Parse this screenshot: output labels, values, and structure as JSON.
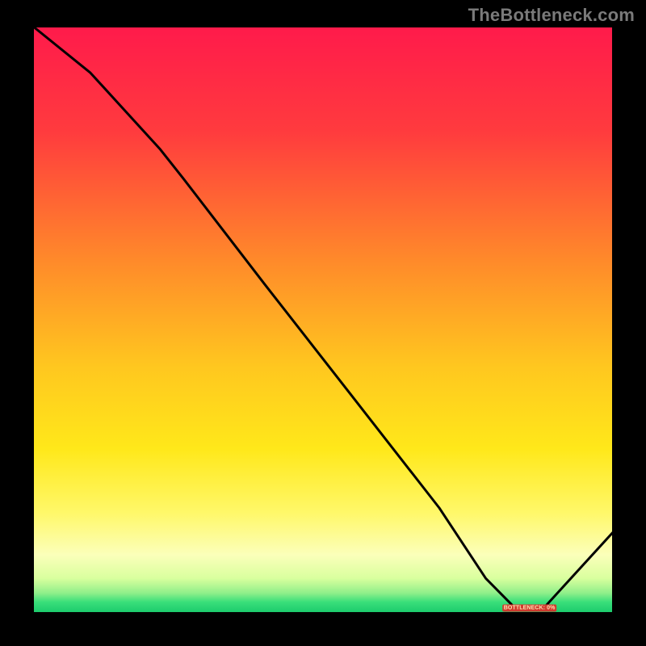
{
  "watermark": "TheBottleneck.com",
  "badge_label": "BOTTLENECK: 0%",
  "chart_data": {
    "type": "line",
    "title": "",
    "xlabel": "",
    "ylabel": "",
    "xlim": [
      0,
      100
    ],
    "ylim": [
      0,
      100
    ],
    "grid": false,
    "legend": false,
    "gradient_stops": [
      {
        "offset": 0,
        "color": "#ff1a4b"
      },
      {
        "offset": 18,
        "color": "#ff3b3e"
      },
      {
        "offset": 40,
        "color": "#ff8a2a"
      },
      {
        "offset": 58,
        "color": "#ffc71f"
      },
      {
        "offset": 72,
        "color": "#ffe81a"
      },
      {
        "offset": 83,
        "color": "#fff86b"
      },
      {
        "offset": 90,
        "color": "#fbffba"
      },
      {
        "offset": 94,
        "color": "#d9ff9e"
      },
      {
        "offset": 96.5,
        "color": "#8fef8a"
      },
      {
        "offset": 98,
        "color": "#3adf7a"
      },
      {
        "offset": 100,
        "color": "#18c96b"
      }
    ],
    "series": [
      {
        "name": "bottleneck-curve",
        "color": "#000000",
        "x": [
          0,
          10,
          22,
          26,
          40,
          55,
          70,
          78,
          83,
          88,
          100
        ],
        "y": [
          100,
          92,
          79,
          74,
          56,
          37,
          18,
          6,
          1,
          1,
          14
        ]
      }
    ],
    "marker": {
      "x": 85.5,
      "y": 1,
      "label_key": "badge_label"
    }
  }
}
